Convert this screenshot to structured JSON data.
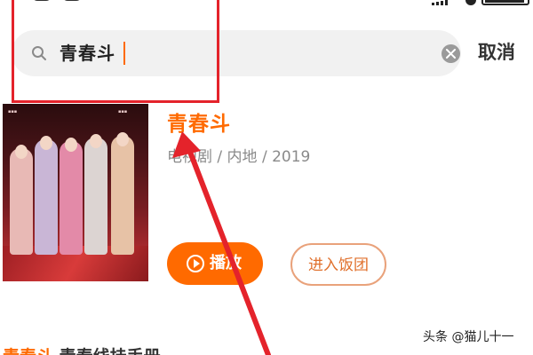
{
  "search": {
    "query": "青春斗",
    "cancel_label": "取消"
  },
  "result": {
    "title": "青春斗",
    "meta": "电视剧 / 内地 / 2019",
    "play_label": "播放",
    "fan_group_label": "进入饭团"
  },
  "next_row": {
    "highlight": "青春斗",
    "rest": " 青春线挂手册"
  },
  "watermark": "头条 @猫儿十一",
  "colors": {
    "accent": "#ff6a00",
    "annotation_red": "#e4232b",
    "search_bg": "#f1f1f1",
    "meta_gray": "#8a8a8a"
  },
  "icons": {
    "search": "search-icon",
    "clear": "clear-icon",
    "play": "play-circle-icon"
  }
}
